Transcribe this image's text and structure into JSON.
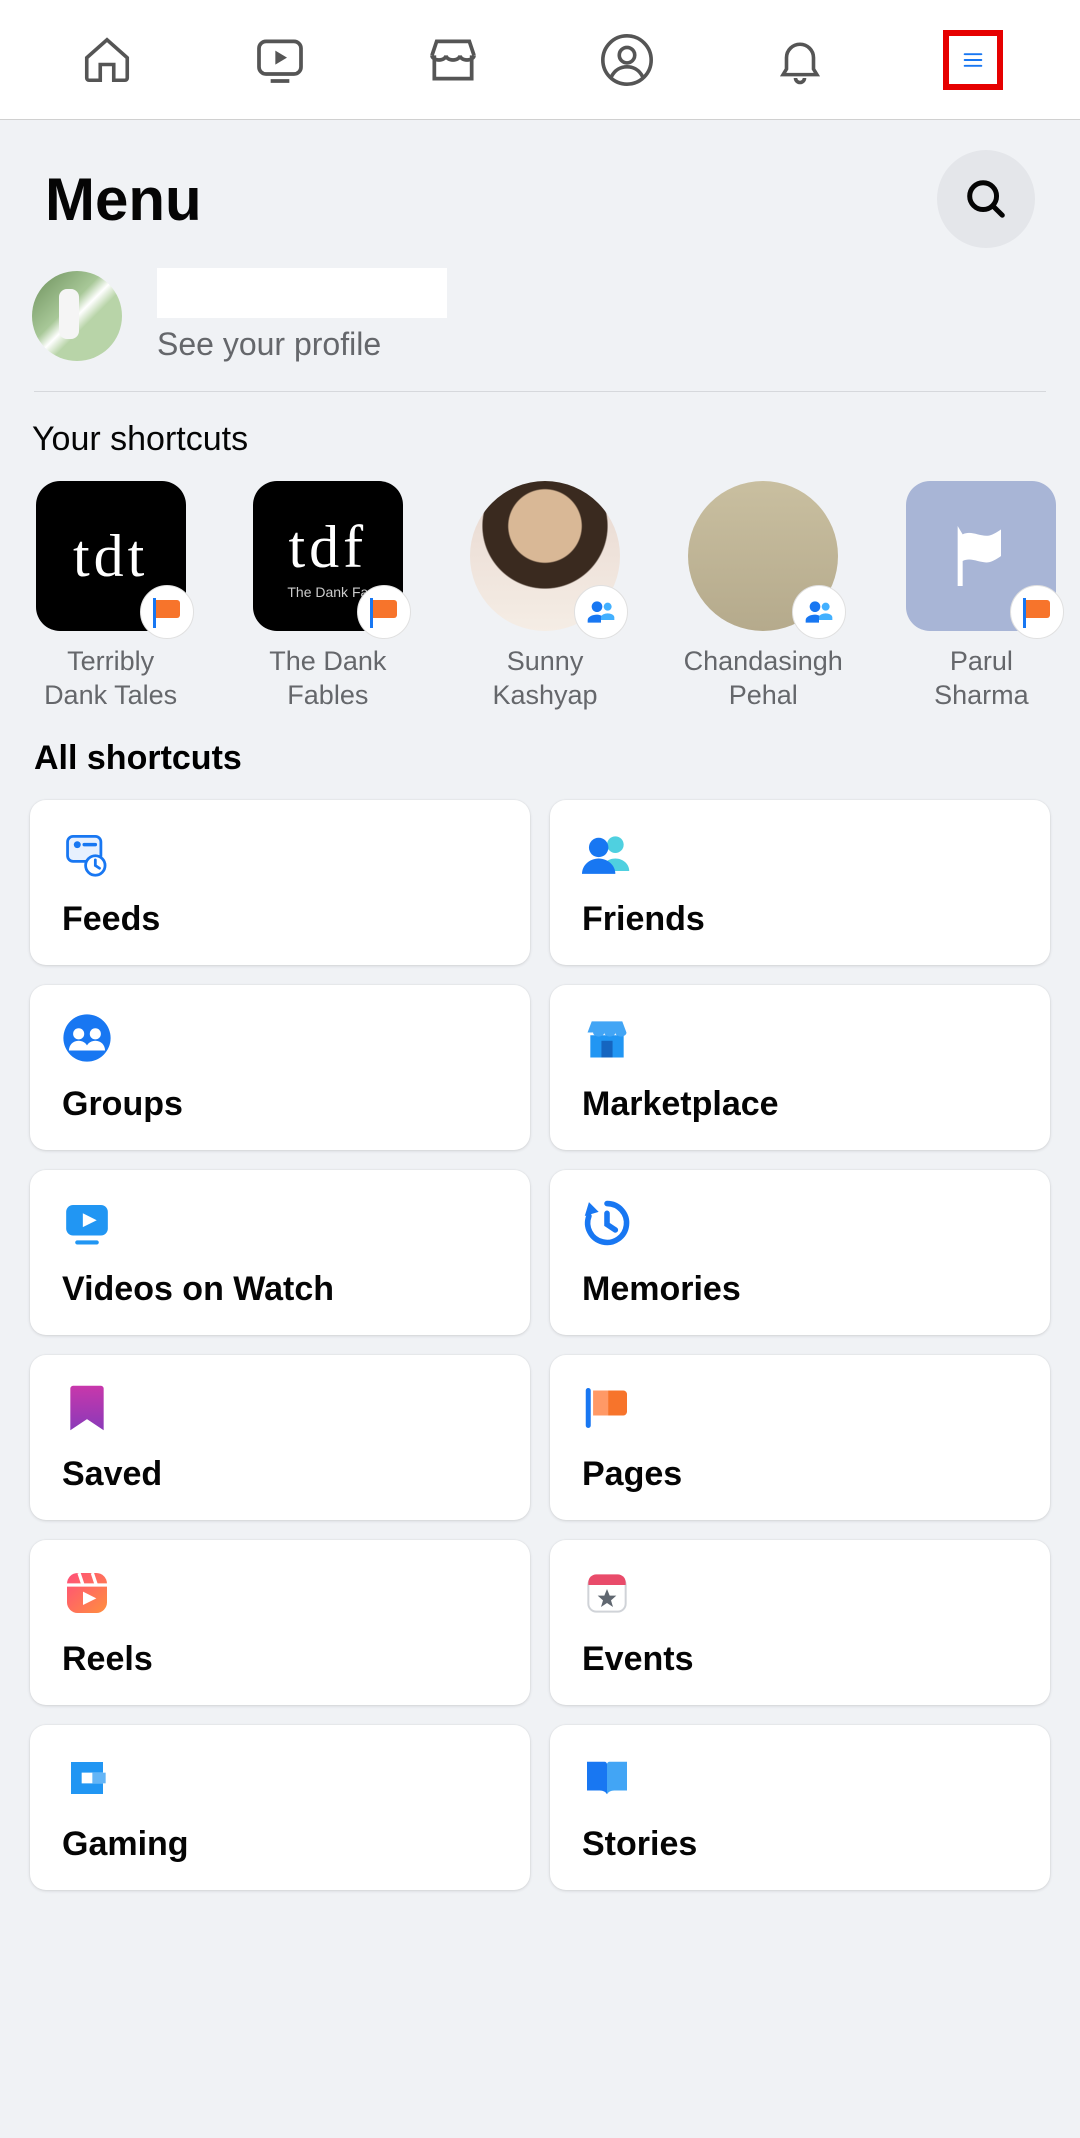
{
  "header": {
    "title": "Menu"
  },
  "profile": {
    "subtitle": "See your profile"
  },
  "sections": {
    "your_shortcuts": "Your shortcuts",
    "all_shortcuts": "All shortcuts"
  },
  "shortcuts": [
    {
      "label": "Terribly Dank Tales",
      "thumb_text": "tdt",
      "thumb_sub": ""
    },
    {
      "label": "The Dank Fables",
      "thumb_text": "tdf",
      "thumb_sub": "The Dank Fa"
    },
    {
      "label": "Sunny Kashyap"
    },
    {
      "label": "Chandasingh Pehal"
    },
    {
      "label": "Parul Sharma"
    }
  ],
  "cards": {
    "feeds": "Feeds",
    "friends": "Friends",
    "groups": "Groups",
    "marketplace": "Marketplace",
    "videos": "Videos on Watch",
    "memories": "Memories",
    "saved": "Saved",
    "pages": "Pages",
    "reels": "Reels",
    "events": "Events",
    "gaming": "Gaming",
    "stories": "Stories"
  },
  "colors": {
    "accent_blue": "#1877f2",
    "bg": "#f0f2f5",
    "text_muted": "#65676b",
    "highlight": "#e60000"
  }
}
